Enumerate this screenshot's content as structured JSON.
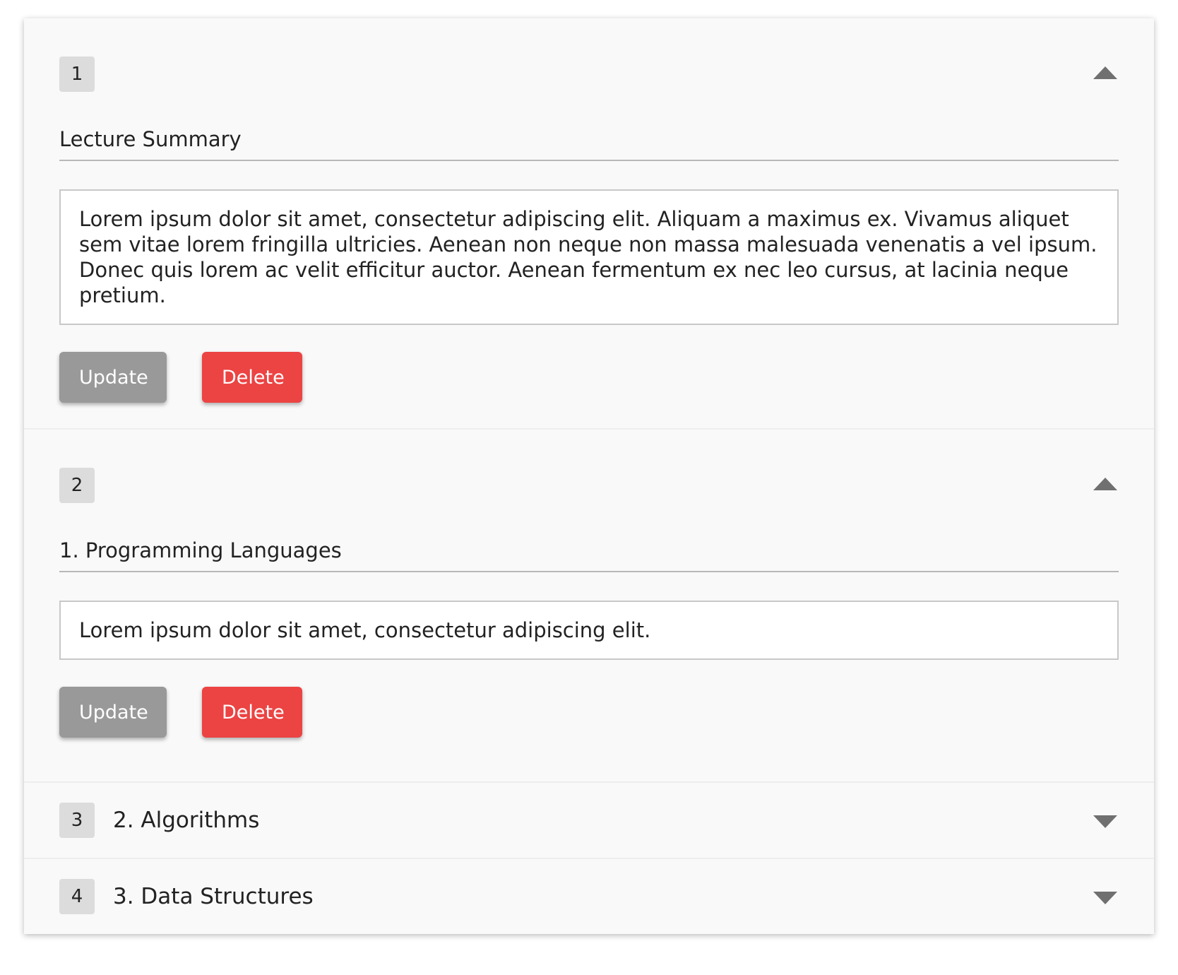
{
  "sections": [
    {
      "number": "1",
      "title": "Lecture Summary",
      "body": "Lorem ipsum dolor sit amet, consectetur adipiscing elit. Aliquam a maximus ex. Vivamus aliquet sem vitae lorem fringilla ultricies. Aenean non neque non massa malesuada venenatis a vel ipsum. Donec quis lorem ac velit efficitur auctor. Aenean fermentum ex nec leo cursus, at lacinia neque pretium.",
      "update_label": "Update",
      "delete_label": "Delete",
      "expanded": true
    },
    {
      "number": "2",
      "title": "1. Programming Languages",
      "body": "Lorem ipsum dolor sit amet, consectetur adipiscing elit.",
      "update_label": "Update",
      "delete_label": "Delete",
      "expanded": true
    },
    {
      "number": "3",
      "title": "2. Algorithms",
      "expanded": false
    },
    {
      "number": "4",
      "title": "3. Data Structures",
      "expanded": false
    }
  ],
  "colors": {
    "update": "#999999",
    "delete": "#ec4343",
    "badge": "#dcdcdc",
    "chevron": "#707070"
  },
  "icons": {
    "expanded": "chevron-up-icon",
    "collapsed": "chevron-down-icon"
  }
}
